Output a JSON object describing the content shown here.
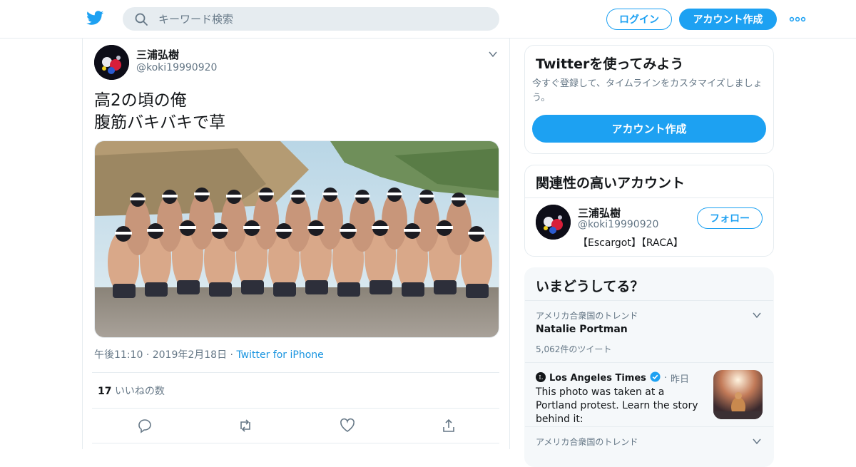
{
  "header": {
    "search_placeholder": "キーワード検索",
    "login_label": "ログイン",
    "signup_label": "アカウント作成"
  },
  "tweet": {
    "author_name": "三浦弘樹",
    "author_handle": "@koki19990920",
    "text_line1": "高2の頃の俺",
    "text_line2": "腹筋バキバキで草",
    "time": "午後11:10",
    "date": "2019年2月18日",
    "source": "Twitter for iPhone",
    "likes_count": "17",
    "likes_label": "いいねの数"
  },
  "sidebar": {
    "signup_card": {
      "title": "Twitterを使ってみよう",
      "subtitle": "今すぐ登録して、タイムラインをカスタマイズしましょう。",
      "button": "アカウント作成"
    },
    "related": {
      "title": "関連性の高いアカウント",
      "name": "三浦弘樹",
      "handle": "@koki19990920",
      "bio": "【Escargot】【RACA】",
      "follow_label": "フォロー"
    },
    "trends": {
      "title": "いまどうしてる？",
      "items": [
        {
          "context": "アメリカ合衆国のトレンド",
          "topic": "Natalie Portman",
          "count": "5,062件のツイート"
        },
        {
          "context": "アメリカ合衆国のトレンド"
        }
      ],
      "news": {
        "source": "Los Angeles Times",
        "time": "昨日",
        "headline": "This photo was taken at a Portland protest. Learn the story behind it:"
      }
    }
  },
  "colors": {
    "accent": "#1da1f2",
    "secondary_text": "#657786",
    "border": "#e6ecf0"
  },
  "icons": [
    "twitter-logo-icon",
    "search-icon",
    "more-dots-icon",
    "chevron-down-icon",
    "reply-icon",
    "retweet-icon",
    "like-icon",
    "share-icon",
    "verified-badge-icon"
  ]
}
